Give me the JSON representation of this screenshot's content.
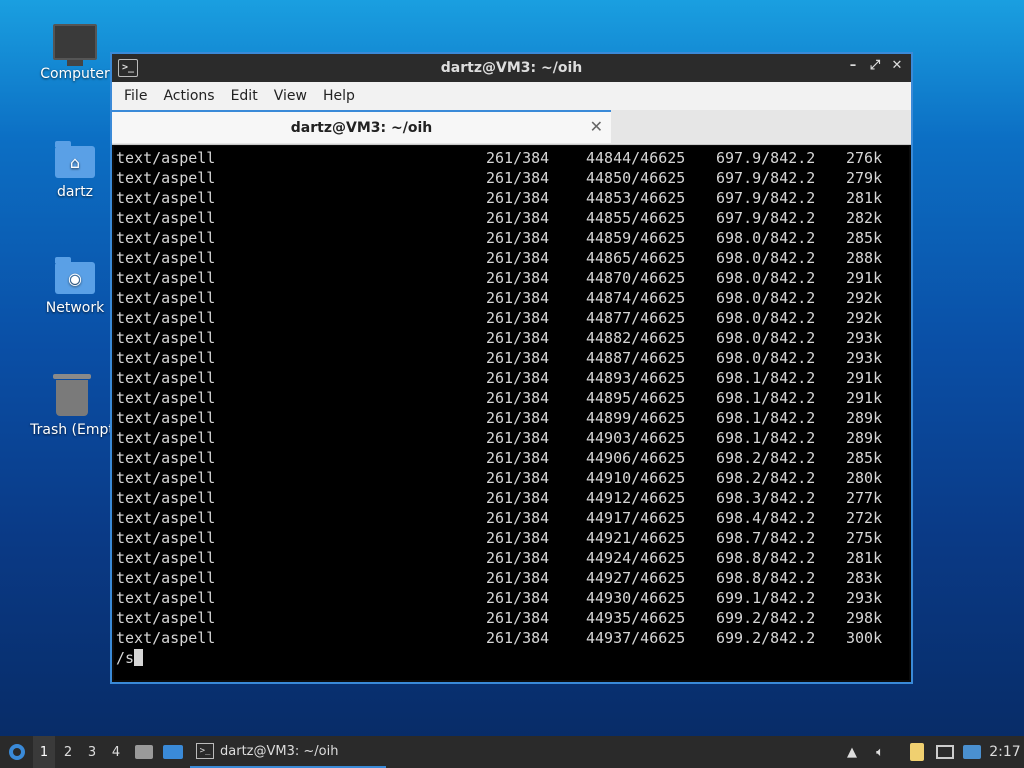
{
  "desktop": {
    "icons": [
      {
        "label": "Computer",
        "icon": "computer-icon"
      },
      {
        "label": "dartz",
        "icon": "home-folder-icon"
      },
      {
        "label": "Network",
        "icon": "network-folder-icon"
      },
      {
        "label": "Trash (Empt",
        "icon": "trash-icon"
      }
    ]
  },
  "window": {
    "title": "dartz@VM3: ~/oih",
    "menu": [
      "File",
      "Actions",
      "Edit",
      "View",
      "Help"
    ],
    "tab_label": "dartz@VM3: ~/oih",
    "controls": {
      "minimize": "–",
      "maximize": "⤢",
      "close": "✕"
    }
  },
  "terminal": {
    "rows": [
      [
        "text/aspell",
        "261/384",
        "44844/46625",
        "697.9/842.2",
        "276k"
      ],
      [
        "text/aspell",
        "261/384",
        "44850/46625",
        "697.9/842.2",
        "279k"
      ],
      [
        "text/aspell",
        "261/384",
        "44853/46625",
        "697.9/842.2",
        "281k"
      ],
      [
        "text/aspell",
        "261/384",
        "44855/46625",
        "697.9/842.2",
        "282k"
      ],
      [
        "text/aspell",
        "261/384",
        "44859/46625",
        "698.0/842.2",
        "285k"
      ],
      [
        "text/aspell",
        "261/384",
        "44865/46625",
        "698.0/842.2",
        "288k"
      ],
      [
        "text/aspell",
        "261/384",
        "44870/46625",
        "698.0/842.2",
        "291k"
      ],
      [
        "text/aspell",
        "261/384",
        "44874/46625",
        "698.0/842.2",
        "292k"
      ],
      [
        "text/aspell",
        "261/384",
        "44877/46625",
        "698.0/842.2",
        "292k"
      ],
      [
        "text/aspell",
        "261/384",
        "44882/46625",
        "698.0/842.2",
        "293k"
      ],
      [
        "text/aspell",
        "261/384",
        "44887/46625",
        "698.0/842.2",
        "293k"
      ],
      [
        "text/aspell",
        "261/384",
        "44893/46625",
        "698.1/842.2",
        "291k"
      ],
      [
        "text/aspell",
        "261/384",
        "44895/46625",
        "698.1/842.2",
        "291k"
      ],
      [
        "text/aspell",
        "261/384",
        "44899/46625",
        "698.1/842.2",
        "289k"
      ],
      [
        "text/aspell",
        "261/384",
        "44903/46625",
        "698.1/842.2",
        "289k"
      ],
      [
        "text/aspell",
        "261/384",
        "44906/46625",
        "698.2/842.2",
        "285k"
      ],
      [
        "text/aspell",
        "261/384",
        "44910/46625",
        "698.2/842.2",
        "280k"
      ],
      [
        "text/aspell",
        "261/384",
        "44912/46625",
        "698.3/842.2",
        "277k"
      ],
      [
        "text/aspell",
        "261/384",
        "44917/46625",
        "698.4/842.2",
        "272k"
      ],
      [
        "text/aspell",
        "261/384",
        "44921/46625",
        "698.7/842.2",
        "275k"
      ],
      [
        "text/aspell",
        "261/384",
        "44924/46625",
        "698.8/842.2",
        "281k"
      ],
      [
        "text/aspell",
        "261/384",
        "44927/46625",
        "698.8/842.2",
        "283k"
      ],
      [
        "text/aspell",
        "261/384",
        "44930/46625",
        "699.1/842.2",
        "293k"
      ],
      [
        "text/aspell",
        "261/384",
        "44935/46625",
        "699.2/842.2",
        "298k"
      ],
      [
        "text/aspell",
        "261/384",
        "44937/46625",
        "699.2/842.2",
        "300k"
      ]
    ],
    "prompt": "/s"
  },
  "taskbar": {
    "workspaces": [
      "1",
      "2",
      "3",
      "4"
    ],
    "active_workspace": "1",
    "task_label": "dartz@VM3: ~/oih",
    "clock": "2:17",
    "tray_icons": [
      "upload-icon",
      "volume-icon",
      "clipboard-icon",
      "network-icon",
      "update-notifier-icon"
    ]
  }
}
